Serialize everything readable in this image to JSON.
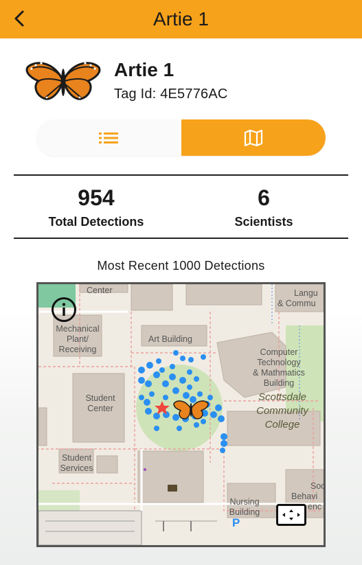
{
  "header": {
    "title": "Artie 1",
    "back_icon": "chevron-left-icon",
    "background_color": "#f7a21b"
  },
  "profile": {
    "name": "Artie 1",
    "tag_id": "Tag Id: 4E5776AC",
    "image_icon": "monarch-butterfly-icon"
  },
  "view_toggle": {
    "list_icon": "list-icon",
    "map_icon": "map-icon",
    "selected": "map",
    "accent_color": "#f7a21b"
  },
  "stats": {
    "total_detections_value": "954",
    "total_detections_label": "Total Detections",
    "scientists_value": "6",
    "scientists_label": "Scientists"
  },
  "map": {
    "caption": "Most Recent 1000 Detections",
    "info_icon": "info-icon",
    "expand_icon": "fullscreen-icon",
    "detection_color": "#2a8ff0",
    "marker_color": "#f0463c",
    "labels": {
      "center": "Center",
      "langu": "Langu",
      "commu": "& Commu",
      "mechanical": "Mechanical",
      "plant": "Plant/",
      "receiving": "Receiving",
      "art_building": "Art Building",
      "computer": "Computer",
      "technology": "Technology",
      "mathmatics": "& Mathmatics",
      "building": "Building",
      "student_center_1": "Student",
      "student_center_2": "Center",
      "scottsdale": "Scottsdale",
      "community": "Community",
      "college": "College",
      "student_services_1": "Student",
      "student_services_2": "Services",
      "nursing": "Nursing",
      "nursing_building": "Building",
      "soci": "Soci",
      "behavi": "Behavi",
      "enc": "enc",
      "parking": "P"
    }
  }
}
